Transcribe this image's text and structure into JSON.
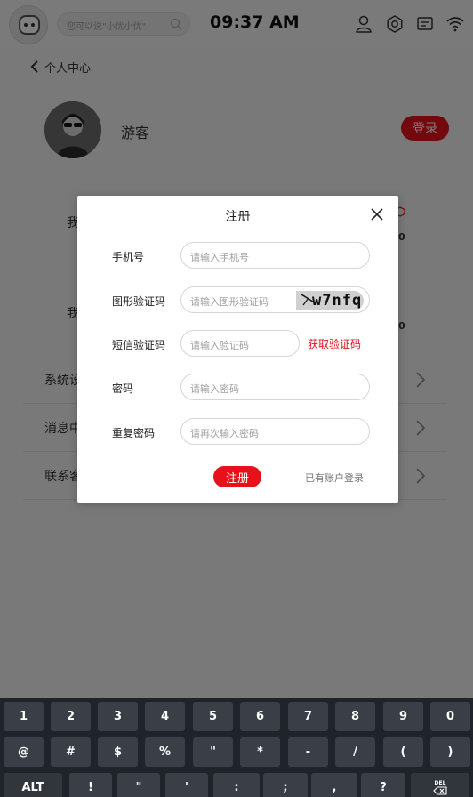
{
  "statusbar": {
    "search_placeholder": "您可以说\"小优小优\"",
    "time": "09:37 AM"
  },
  "page": {
    "back_label": "个人中心",
    "username": "游客",
    "login_label": "登录",
    "side_texts": [
      "我",
      "我"
    ],
    "side_nums": [
      "0",
      "0"
    ],
    "menu": [
      {
        "label": "系统设"
      },
      {
        "label": "消息中"
      },
      {
        "label": "联系客"
      }
    ]
  },
  "dialog": {
    "title": "注册",
    "fields": [
      {
        "label": "手机号",
        "placeholder": "请输入手机号"
      },
      {
        "label": "图形验证码",
        "placeholder": "请输入图形验证码"
      },
      {
        "label": "短信验证码",
        "placeholder": "请输入验证码"
      },
      {
        "label": "密码",
        "placeholder": "请输入密码"
      },
      {
        "label": "重复密码",
        "placeholder": "请再次输入密码"
      }
    ],
    "captcha_text": "w7nfq",
    "sms_button": "获取验证码",
    "register_button": "注册",
    "have_account": "已有账户登录"
  },
  "keyboard": {
    "row1": [
      "1",
      "2",
      "3",
      "4",
      "5",
      "6",
      "7",
      "8",
      "9",
      "0"
    ],
    "row2": [
      "@",
      "#",
      "$",
      "%",
      "\"",
      "*",
      "-",
      "/",
      "(",
      ")"
    ],
    "row3": [
      "ALT",
      "!",
      "\"",
      "'",
      ":",
      ";",
      ",",
      "?",
      "DEL"
    ]
  },
  "colors": {
    "accent": "#e6111b",
    "keyboard_bg": "#1f232a"
  }
}
